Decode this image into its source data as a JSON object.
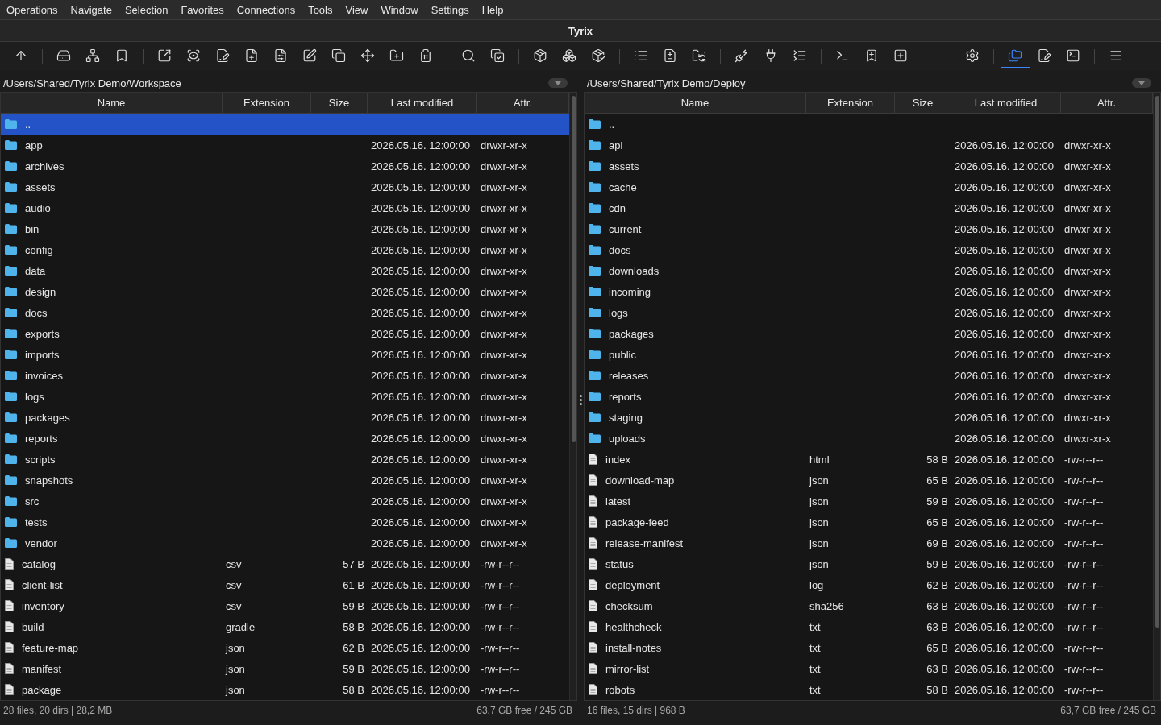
{
  "menu": [
    "Operations",
    "Navigate",
    "Selection",
    "Favorites",
    "Connections",
    "Tools",
    "View",
    "Window",
    "Settings",
    "Help"
  ],
  "window": {
    "title": "Tyrix"
  },
  "toolbar": {
    "groups": [
      [
        {
          "kind": "up",
          "selected": false
        }
      ],
      [
        {
          "kind": "drive",
          "selected": false
        },
        {
          "kind": "network",
          "selected": false
        },
        {
          "kind": "bookmark",
          "selected": false
        }
      ],
      [
        {
          "kind": "open-external",
          "selected": false
        },
        {
          "kind": "view",
          "selected": false
        },
        {
          "kind": "edit-file",
          "selected": false
        },
        {
          "kind": "new-file",
          "selected": false
        },
        {
          "kind": "file-compare",
          "selected": false
        },
        {
          "kind": "rename",
          "selected": false
        },
        {
          "kind": "copy",
          "selected": false
        },
        {
          "kind": "move",
          "selected": false
        },
        {
          "kind": "new-folder",
          "selected": false
        },
        {
          "kind": "delete",
          "selected": false
        }
      ],
      [
        {
          "kind": "search",
          "selected": false
        },
        {
          "kind": "copy-check",
          "selected": false
        }
      ],
      [
        {
          "kind": "pack",
          "selected": false
        },
        {
          "kind": "unpack",
          "selected": false
        },
        {
          "kind": "pack-check",
          "selected": false
        }
      ],
      [
        {
          "kind": "list",
          "selected": false
        },
        {
          "kind": "diff",
          "selected": false
        },
        {
          "kind": "sync",
          "selected": false
        }
      ],
      [
        {
          "kind": "connect",
          "selected": false
        },
        {
          "kind": "disconnect",
          "selected": false
        },
        {
          "kind": "dotted-list",
          "selected": false
        }
      ],
      [
        {
          "kind": "terminal",
          "selected": false
        },
        {
          "kind": "bookmark-add",
          "selected": false
        },
        {
          "kind": "add",
          "selected": false
        }
      ],
      [
        {
          "kind": "settings",
          "selected": false
        }
      ],
      [
        {
          "kind": "folders",
          "selected": true
        },
        {
          "kind": "edit-file",
          "selected": false
        },
        {
          "kind": "terminal-box",
          "selected": false
        }
      ],
      [
        {
          "kind": "menu",
          "selected": false
        }
      ]
    ]
  },
  "panels": [
    {
      "path": "/Users/Shared/Tyrix Demo/Workspace",
      "columns": [
        "Name",
        "Extension",
        "Size",
        "Last modified",
        "Attr."
      ],
      "status_left": "28 files, 20 dirs | 28,2 MB",
      "status_right": "63,7 GB free / 245 GB",
      "rows": [
        {
          "kind": "folder",
          "name": "..",
          "selected": true
        },
        {
          "kind": "folder",
          "name": "app",
          "modified": "2026.05.16. 12:00:00",
          "attr": "drwxr-xr-x",
          "selected": false
        },
        {
          "kind": "folder",
          "name": "archives",
          "modified": "2026.05.16. 12:00:00",
          "attr": "drwxr-xr-x",
          "selected": false
        },
        {
          "kind": "folder",
          "name": "assets",
          "modified": "2026.05.16. 12:00:00",
          "attr": "drwxr-xr-x",
          "selected": false
        },
        {
          "kind": "folder",
          "name": "audio",
          "modified": "2026.05.16. 12:00:00",
          "attr": "drwxr-xr-x",
          "selected": false
        },
        {
          "kind": "folder",
          "name": "bin",
          "modified": "2026.05.16. 12:00:00",
          "attr": "drwxr-xr-x",
          "selected": false
        },
        {
          "kind": "folder",
          "name": "config",
          "modified": "2026.05.16. 12:00:00",
          "attr": "drwxr-xr-x",
          "selected": false
        },
        {
          "kind": "folder",
          "name": "data",
          "modified": "2026.05.16. 12:00:00",
          "attr": "drwxr-xr-x",
          "selected": false
        },
        {
          "kind": "folder",
          "name": "design",
          "modified": "2026.05.16. 12:00:00",
          "attr": "drwxr-xr-x",
          "selected": false
        },
        {
          "kind": "folder",
          "name": "docs",
          "modified": "2026.05.16. 12:00:00",
          "attr": "drwxr-xr-x",
          "selected": false
        },
        {
          "kind": "folder",
          "name": "exports",
          "modified": "2026.05.16. 12:00:00",
          "attr": "drwxr-xr-x",
          "selected": false
        },
        {
          "kind": "folder",
          "name": "imports",
          "modified": "2026.05.16. 12:00:00",
          "attr": "drwxr-xr-x",
          "selected": false
        },
        {
          "kind": "folder",
          "name": "invoices",
          "modified": "2026.05.16. 12:00:00",
          "attr": "drwxr-xr-x",
          "selected": false
        },
        {
          "kind": "folder",
          "name": "logs",
          "modified": "2026.05.16. 12:00:00",
          "attr": "drwxr-xr-x",
          "selected": false
        },
        {
          "kind": "folder",
          "name": "packages",
          "modified": "2026.05.16. 12:00:00",
          "attr": "drwxr-xr-x",
          "selected": false
        },
        {
          "kind": "folder",
          "name": "reports",
          "modified": "2026.05.16. 12:00:00",
          "attr": "drwxr-xr-x",
          "selected": false
        },
        {
          "kind": "folder",
          "name": "scripts",
          "modified": "2026.05.16. 12:00:00",
          "attr": "drwxr-xr-x",
          "selected": false
        },
        {
          "kind": "folder",
          "name": "snapshots",
          "modified": "2026.05.16. 12:00:00",
          "attr": "drwxr-xr-x",
          "selected": false
        },
        {
          "kind": "folder",
          "name": "src",
          "modified": "2026.05.16. 12:00:00",
          "attr": "drwxr-xr-x",
          "selected": false
        },
        {
          "kind": "folder",
          "name": "tests",
          "modified": "2026.05.16. 12:00:00",
          "attr": "drwxr-xr-x",
          "selected": false
        },
        {
          "kind": "folder",
          "name": "vendor",
          "modified": "2026.05.16. 12:00:00",
          "attr": "drwxr-xr-x",
          "selected": false
        },
        {
          "kind": "file",
          "name": "catalog",
          "ext": "csv",
          "size": "57 B",
          "modified": "2026.05.16. 12:00:00",
          "attr": "-rw-r--r--",
          "selected": false
        },
        {
          "kind": "file",
          "name": "client-list",
          "ext": "csv",
          "size": "61 B",
          "modified": "2026.05.16. 12:00:00",
          "attr": "-rw-r--r--",
          "selected": false
        },
        {
          "kind": "file",
          "name": "inventory",
          "ext": "csv",
          "size": "59 B",
          "modified": "2026.05.16. 12:00:00",
          "attr": "-rw-r--r--",
          "selected": false
        },
        {
          "kind": "file",
          "name": "build",
          "ext": "gradle",
          "size": "58 B",
          "modified": "2026.05.16. 12:00:00",
          "attr": "-rw-r--r--",
          "selected": false
        },
        {
          "kind": "file",
          "name": "feature-map",
          "ext": "json",
          "size": "62 B",
          "modified": "2026.05.16. 12:00:00",
          "attr": "-rw-r--r--",
          "selected": false
        },
        {
          "kind": "file",
          "name": "manifest",
          "ext": "json",
          "size": "59 B",
          "modified": "2026.05.16. 12:00:00",
          "attr": "-rw-r--r--",
          "selected": false
        },
        {
          "kind": "file",
          "name": "package",
          "ext": "json",
          "size": "58 B",
          "modified": "2026.05.16. 12:00:00",
          "attr": "-rw-r--r--",
          "selected": false
        }
      ]
    },
    {
      "path": "/Users/Shared/Tyrix Demo/Deploy",
      "columns": [
        "Name",
        "Extension",
        "Size",
        "Last modified",
        "Attr."
      ],
      "status_left": "16 files, 15 dirs | 968 B",
      "status_right": "63,7 GB free / 245 GB",
      "rows": [
        {
          "kind": "folder",
          "name": "..",
          "selected": false
        },
        {
          "kind": "folder",
          "name": "api",
          "modified": "2026.05.16. 12:00:00",
          "attr": "drwxr-xr-x",
          "selected": false
        },
        {
          "kind": "folder",
          "name": "assets",
          "modified": "2026.05.16. 12:00:00",
          "attr": "drwxr-xr-x",
          "selected": false
        },
        {
          "kind": "folder",
          "name": "cache",
          "modified": "2026.05.16. 12:00:00",
          "attr": "drwxr-xr-x",
          "selected": false
        },
        {
          "kind": "folder",
          "name": "cdn",
          "modified": "2026.05.16. 12:00:00",
          "attr": "drwxr-xr-x",
          "selected": false
        },
        {
          "kind": "folder",
          "name": "current",
          "modified": "2026.05.16. 12:00:00",
          "attr": "drwxr-xr-x",
          "selected": false
        },
        {
          "kind": "folder",
          "name": "docs",
          "modified": "2026.05.16. 12:00:00",
          "attr": "drwxr-xr-x",
          "selected": false
        },
        {
          "kind": "folder",
          "name": "downloads",
          "modified": "2026.05.16. 12:00:00",
          "attr": "drwxr-xr-x",
          "selected": false
        },
        {
          "kind": "folder",
          "name": "incoming",
          "modified": "2026.05.16. 12:00:00",
          "attr": "drwxr-xr-x",
          "selected": false
        },
        {
          "kind": "folder",
          "name": "logs",
          "modified": "2026.05.16. 12:00:00",
          "attr": "drwxr-xr-x",
          "selected": false
        },
        {
          "kind": "folder",
          "name": "packages",
          "modified": "2026.05.16. 12:00:00",
          "attr": "drwxr-xr-x",
          "selected": false
        },
        {
          "kind": "folder",
          "name": "public",
          "modified": "2026.05.16. 12:00:00",
          "attr": "drwxr-xr-x",
          "selected": false
        },
        {
          "kind": "folder",
          "name": "releases",
          "modified": "2026.05.16. 12:00:00",
          "attr": "drwxr-xr-x",
          "selected": false
        },
        {
          "kind": "folder",
          "name": "reports",
          "modified": "2026.05.16. 12:00:00",
          "attr": "drwxr-xr-x",
          "selected": false
        },
        {
          "kind": "folder",
          "name": "staging",
          "modified": "2026.05.16. 12:00:00",
          "attr": "drwxr-xr-x",
          "selected": false
        },
        {
          "kind": "folder",
          "name": "uploads",
          "modified": "2026.05.16. 12:00:00",
          "attr": "drwxr-xr-x",
          "selected": false
        },
        {
          "kind": "file",
          "name": "index",
          "ext": "html",
          "size": "58 B",
          "modified": "2026.05.16. 12:00:00",
          "attr": "-rw-r--r--",
          "selected": false
        },
        {
          "kind": "file",
          "name": "download-map",
          "ext": "json",
          "size": "65 B",
          "modified": "2026.05.16. 12:00:00",
          "attr": "-rw-r--r--",
          "selected": false
        },
        {
          "kind": "file",
          "name": "latest",
          "ext": "json",
          "size": "59 B",
          "modified": "2026.05.16. 12:00:00",
          "attr": "-rw-r--r--",
          "selected": false
        },
        {
          "kind": "file",
          "name": "package-feed",
          "ext": "json",
          "size": "65 B",
          "modified": "2026.05.16. 12:00:00",
          "attr": "-rw-r--r--",
          "selected": false
        },
        {
          "kind": "file",
          "name": "release-manifest",
          "ext": "json",
          "size": "69 B",
          "modified": "2026.05.16. 12:00:00",
          "attr": "-rw-r--r--",
          "selected": false
        },
        {
          "kind": "file",
          "name": "status",
          "ext": "json",
          "size": "59 B",
          "modified": "2026.05.16. 12:00:00",
          "attr": "-rw-r--r--",
          "selected": false
        },
        {
          "kind": "file",
          "name": "deployment",
          "ext": "log",
          "size": "62 B",
          "modified": "2026.05.16. 12:00:00",
          "attr": "-rw-r--r--",
          "selected": false
        },
        {
          "kind": "file",
          "name": "checksum",
          "ext": "sha256",
          "size": "63 B",
          "modified": "2026.05.16. 12:00:00",
          "attr": "-rw-r--r--",
          "selected": false
        },
        {
          "kind": "file",
          "name": "healthcheck",
          "ext": "txt",
          "size": "63 B",
          "modified": "2026.05.16. 12:00:00",
          "attr": "-rw-r--r--",
          "selected": false
        },
        {
          "kind": "file",
          "name": "install-notes",
          "ext": "txt",
          "size": "65 B",
          "modified": "2026.05.16. 12:00:00",
          "attr": "-rw-r--r--",
          "selected": false
        },
        {
          "kind": "file",
          "name": "mirror-list",
          "ext": "txt",
          "size": "63 B",
          "modified": "2026.05.16. 12:00:00",
          "attr": "-rw-r--r--",
          "selected": false
        },
        {
          "kind": "file",
          "name": "robots",
          "ext": "txt",
          "size": "58 B",
          "modified": "2026.05.16. 12:00:00",
          "attr": "-rw-r--r--",
          "selected": false
        }
      ]
    }
  ]
}
